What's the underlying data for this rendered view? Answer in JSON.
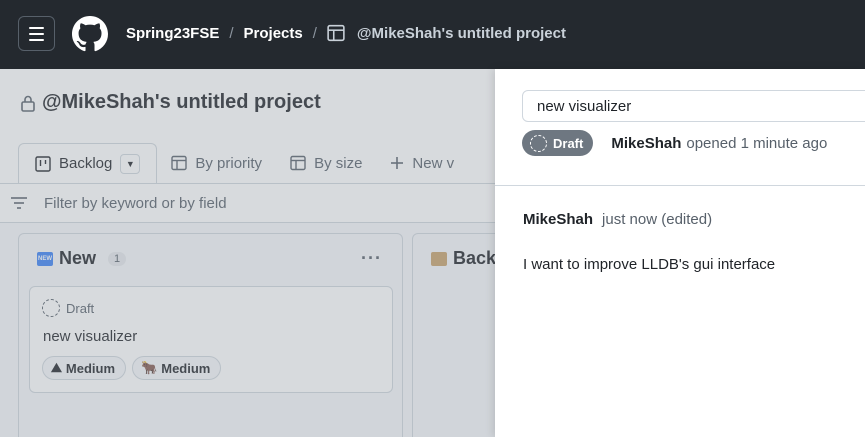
{
  "header": {
    "breadcrumbs": [
      "Spring23FSE",
      "Projects",
      "@MikeShah's untitled project"
    ],
    "separator": "/",
    "menu_icon": "hamburger-icon",
    "logo_icon": "github-logo-icon"
  },
  "project": {
    "title": "@MikeShah's untitled project",
    "lock_icon": "lock-icon",
    "tabs": [
      {
        "label": "Backlog",
        "icon": "board-icon",
        "active": true
      },
      {
        "label": "By priority",
        "icon": "table-icon"
      },
      {
        "label": "By size",
        "icon": "table-icon"
      },
      {
        "label": "New v",
        "icon": "plus-icon"
      }
    ],
    "filter_placeholder": "Filter by keyword or by field"
  },
  "board": {
    "columns": [
      {
        "name": "New",
        "count": "1",
        "emoji": "NEW",
        "cards": [
          {
            "status": "Draft",
            "title": "new visualizer",
            "labels": [
              {
                "text": "Medium",
                "emoji": "⛰"
              },
              {
                "text": "Medium",
                "emoji": "🐂"
              }
            ]
          }
        ]
      },
      {
        "name": "Back",
        "emoji": "clipboard"
      }
    ],
    "more_glyph": "···"
  },
  "panel": {
    "title_value": "new visualizer",
    "status": "Draft",
    "author": "MikeShah",
    "opened_text": "opened 1 minute ago",
    "comment": {
      "author": "MikeShah",
      "time": "just now (edited)",
      "body": "I want to improve LLDB's gui interface"
    }
  },
  "colors": {
    "header_bg": "#24292f",
    "draft_badge_bg": "#6e7781",
    "border": "#d0d7de"
  }
}
